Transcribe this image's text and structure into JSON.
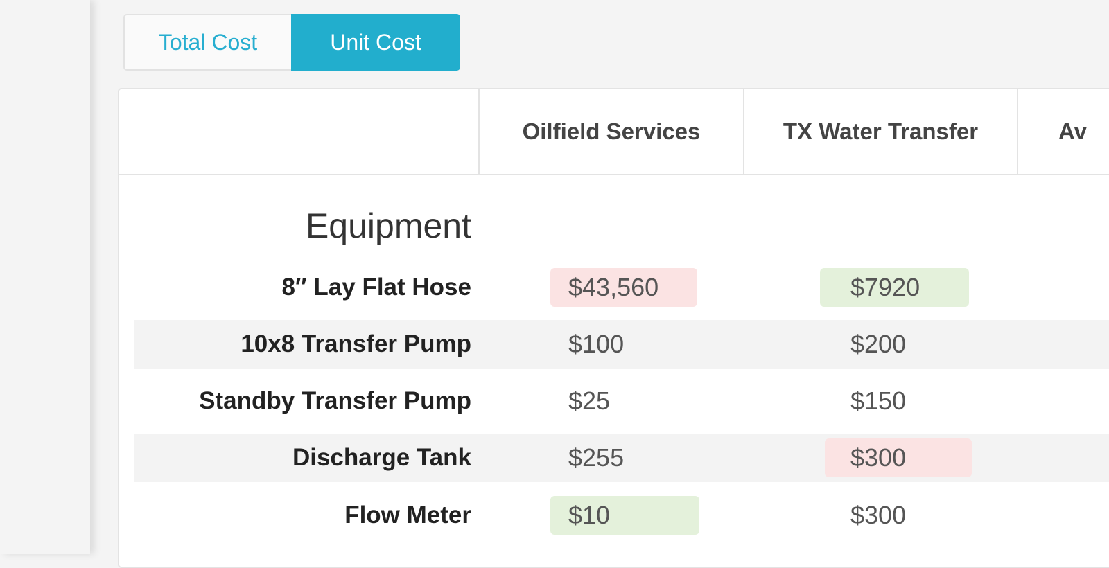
{
  "toggle": {
    "total_label": "Total Cost",
    "unit_label": "Unit Cost",
    "active": "Unit Cost"
  },
  "columns": [
    "Oilfield Services",
    "TX Water Transfer",
    "Av"
  ],
  "section": "Equipment",
  "rows": [
    {
      "label": "8″ Lay Flat Hose",
      "values": [
        "$43,560",
        "$7920"
      ],
      "highlight": [
        "red",
        "green"
      ]
    },
    {
      "label": "10x8 Transfer Pump",
      "values": [
        "$100",
        "$200"
      ],
      "highlight": [
        "none",
        "none"
      ]
    },
    {
      "label": "Standby Transfer Pump",
      "values": [
        "$25",
        "$150"
      ],
      "highlight": [
        "none",
        "none"
      ]
    },
    {
      "label": "Discharge Tank",
      "values": [
        "$255",
        "$300"
      ],
      "highlight": [
        "none",
        "red"
      ]
    },
    {
      "label": "Flow Meter",
      "values": [
        "$10",
        "$300"
      ],
      "highlight": [
        "green",
        "none"
      ]
    }
  ],
  "colors": {
    "accent": "#22aecd",
    "highlight_red": "#fbe3e3",
    "highlight_green": "#e4f1db"
  }
}
